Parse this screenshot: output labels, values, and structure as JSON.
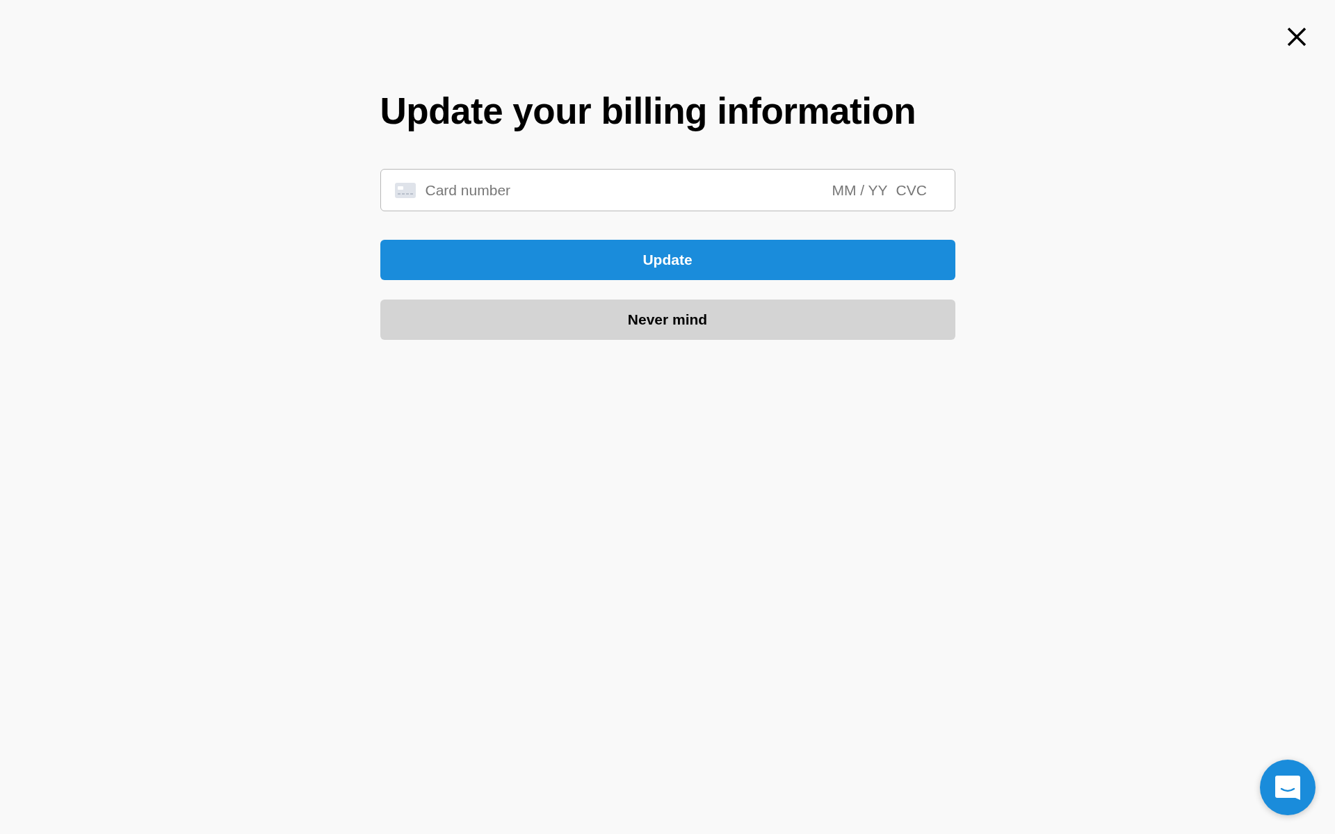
{
  "dialog": {
    "title": "Update your billing information",
    "card_field": {
      "number_placeholder": "Card number",
      "expiry_placeholder": "MM / YY",
      "cvc_placeholder": "CVC"
    },
    "buttons": [
      {
        "label": "Update",
        "kind": "primary"
      },
      {
        "label": "Never mind",
        "kind": "secondary"
      }
    ]
  }
}
